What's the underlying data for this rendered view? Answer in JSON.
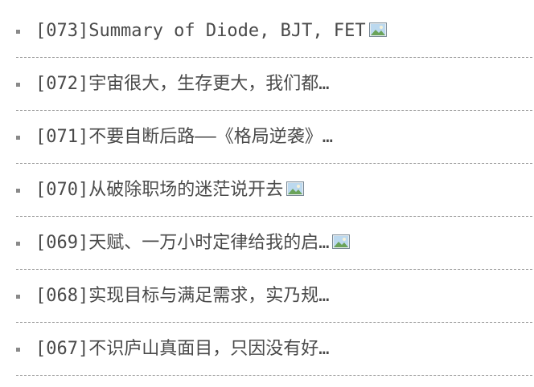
{
  "articles": [
    {
      "text": "[073]Summary of Diode, BJT, FET",
      "has_image": true
    },
    {
      "text": "[072]宇宙很大，生存更大，我们都…",
      "has_image": false
    },
    {
      "text": "[071]不要自断后路——《格局逆袭》…",
      "has_image": false
    },
    {
      "text": "[070]从破除职场的迷茫说开去",
      "has_image": true
    },
    {
      "text": "[069]天赋、一万小时定律给我的启…",
      "has_image": true
    },
    {
      "text": "[068]实现目标与满足需求，实乃规…",
      "has_image": false
    },
    {
      "text": "[067]不识庐山真面目，只因没有好…",
      "has_image": false
    }
  ],
  "icon": "image-icon",
  "colors": {
    "text": "#4a4a4a",
    "divider": "#9a9a9a",
    "bullet": "#8a8a8a"
  }
}
